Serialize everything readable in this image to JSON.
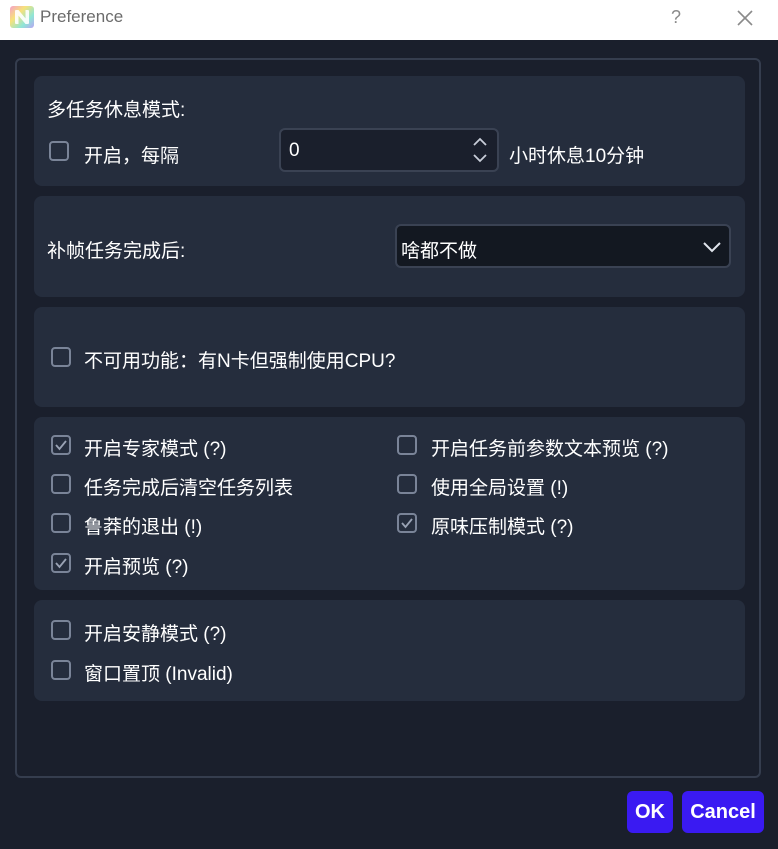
{
  "window": {
    "title": "Preference",
    "help_label": "?"
  },
  "rest_mode": {
    "heading": "多任务休息模式:",
    "enable_label": "开启，每隔",
    "enabled": false,
    "interval_value": "0",
    "suffix": "小时休息10分钟"
  },
  "after_complete": {
    "label": "补帧任务完成后:",
    "selected": "啥都不做"
  },
  "unavailable": {
    "label": "不可用功能：有N卡但强制使用CPU?",
    "checked": false
  },
  "options": [
    {
      "label": "开启专家模式 (?)",
      "checked": true
    },
    {
      "label": "开启任务前参数文本预览 (?)",
      "checked": false
    },
    {
      "label": "任务完成后清空任务列表",
      "checked": false
    },
    {
      "label": "使用全局设置 (!)",
      "checked": false
    },
    {
      "label": "鲁莽的退出 (!)",
      "checked": false
    },
    {
      "label": "原味压制模式 (?)",
      "checked": true
    },
    {
      "label": "开启预览 (?)",
      "checked": true
    }
  ],
  "misc": [
    {
      "label": "开启安静模式 (?)",
      "checked": false
    },
    {
      "label": "窗口置顶 (Invalid)",
      "checked": false
    }
  ],
  "buttons": {
    "ok": "OK",
    "cancel": "Cancel"
  },
  "colors": {
    "background": "#1a1f2c",
    "panel": "#252d3d",
    "accent_button": "#3a1af2"
  }
}
